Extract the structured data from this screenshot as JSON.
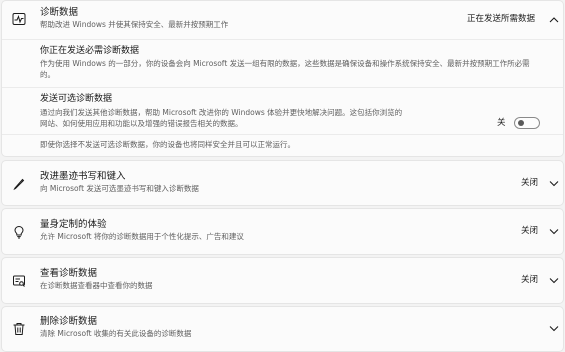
{
  "diagnostic": {
    "title": "诊断数据",
    "desc": "帮助改进 Windows 并使其保持安全、最新并按预期工作",
    "status": "正在发送所需数据",
    "required": {
      "title": "你正在发送必需诊断数据",
      "desc": "作为使用 Windows 的一部分，你的设备会向 Microsoft 发送一组有限的数据，这些数据是确保设备和操作系统保持安全、最新并按预期工作所必需的。"
    },
    "optional": {
      "title": "发送可选诊断数据",
      "desc": "通过向我们发送其他诊断数据，帮助 Microsoft 改进你的 Windows 体验并更快地解决问题。这包括你浏览的网站、如何使用应用和功能以及增强的错误报告相关的数据。",
      "toggle_label": "关",
      "toggle_on": false
    },
    "note": "即使你选择不发送可选诊断数据，你的设备也将同样安全并且可以正常运行。"
  },
  "inking": {
    "title": "改进墨迹书写和键入",
    "desc": "向 Microsoft 发送可选墨迹书写和键入诊断数据",
    "status": "关闭"
  },
  "tailored": {
    "title": "量身定制的体验",
    "desc": "允许 Microsoft 将你的诊断数据用于个性化提示、广告和建议",
    "status": "关闭"
  },
  "viewer": {
    "title": "查看诊断数据",
    "desc": "在诊断数据查看器中查看你的数据",
    "status": "关闭"
  },
  "delete": {
    "title": "删除诊断数据",
    "desc": "清除 Microsoft 收集的有关此设备的诊断数据"
  }
}
